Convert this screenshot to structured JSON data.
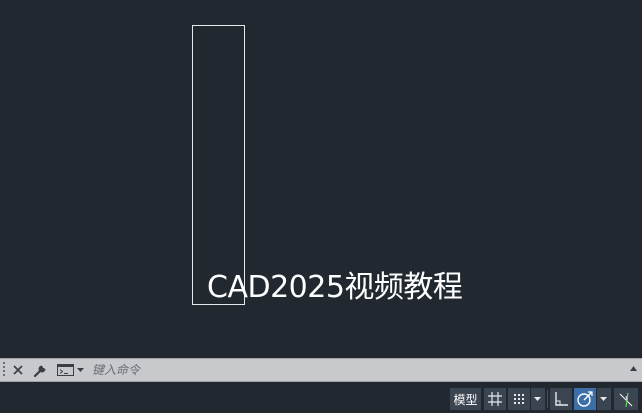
{
  "canvas": {
    "background": "#212830",
    "line_color": "#e6e9ec",
    "watermark_text": "CAD2025视频教程"
  },
  "command_line": {
    "placeholder": "键入命令",
    "close_icon": "close-icon",
    "customize_icon": "wrench-icon",
    "recent_icon": "command-prompt-icon"
  },
  "status_bar": {
    "model_label": "模型",
    "icons": [
      "grid-icon",
      "snap-icon",
      "ortho-icon",
      "polar-icon",
      "isodraft-icon"
    ],
    "accent": "#3c6fa8"
  }
}
